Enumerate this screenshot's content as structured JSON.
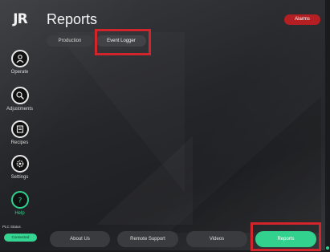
{
  "app": {
    "logo_text": "JR",
    "title": "Reports"
  },
  "header": {
    "alarms_label": "Alarms"
  },
  "tabs": {
    "production": "Production",
    "event_logger": "Event Logger"
  },
  "sidebar": {
    "items": [
      {
        "label": "Operate",
        "icon": "operate-icon"
      },
      {
        "label": "Adjustments",
        "icon": "adjustments-icon"
      },
      {
        "label": "Recipes",
        "icon": "recipes-icon"
      },
      {
        "label": "Settings",
        "icon": "settings-icon"
      },
      {
        "label": "Help",
        "icon": "help-icon"
      }
    ],
    "plc_status_label": "PLC Status",
    "plc_status_value": "Connected"
  },
  "footer": {
    "about_label": "About Us",
    "remote_label": "Remote Support",
    "videos_label": "Videos",
    "reports_label": "Reports"
  },
  "colors": {
    "accent_green": "#33d18e",
    "alarm_red": "#b31f22",
    "highlight_red": "#d1252b"
  }
}
